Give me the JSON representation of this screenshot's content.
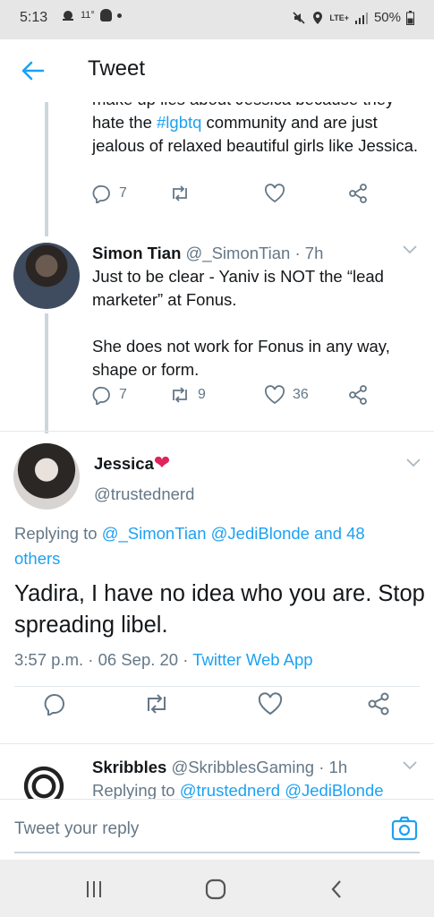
{
  "status_bar": {
    "time": "5:13",
    "temp": "11°",
    "lte": "LTE+",
    "battery": "50%",
    "icons": [
      "weather-icon",
      "snapchat-icon",
      "dot-icon",
      "mute-icon",
      "location-icon",
      "lte-icon",
      "signal-icon",
      "battery-icon"
    ]
  },
  "header": {
    "title": "Tweet",
    "back_icon": "arrow-left-icon"
  },
  "tweet1": {
    "partial_line": "make up lies about Jessica because they",
    "text_before_tag": "hate the ",
    "hashtag": "#lgbtq",
    "text_after_tag": " community and are just jealous of relaxed beautiful girls like Jessica.",
    "replies": "7",
    "retweets": "",
    "likes": ""
  },
  "tweet2": {
    "name": "Simon Tian",
    "handle": "@_SimonTian",
    "separator": "·",
    "time": "7h",
    "para1": "Just to be clear - Yaniv is NOT the “lead marketer” at Fonus.",
    "para2": "She does not work for Fonus in any way, shape or form.",
    "replies": "7",
    "retweets": "9",
    "likes": "36"
  },
  "main_tweet": {
    "name": "Jessica",
    "emoji": "❤",
    "handle": "@trustednerd",
    "replying_prefix": "Replying to ",
    "replying_to": "@_SimonTian @JediBlonde and 48 others",
    "text": "Yadira, I have no idea who you are. Stop spreading libel.",
    "time": "3:57 p.m.",
    "sep": "·",
    "date": "06 Sep. 20",
    "sep2": "·",
    "source": "Twitter Web App"
  },
  "tweet3": {
    "name": "Skribbles",
    "handle": "@SkribblesGaming",
    "separator": "·",
    "time": "1h",
    "replying_prefix": "Replying to ",
    "replying_to": "@trustednerd @JediBlonde"
  },
  "reply_bar": {
    "placeholder": "Tweet your reply"
  },
  "colors": {
    "accent": "#1da1f2",
    "text": "#14171a",
    "muted": "#657786",
    "heart": "#e0245e"
  }
}
